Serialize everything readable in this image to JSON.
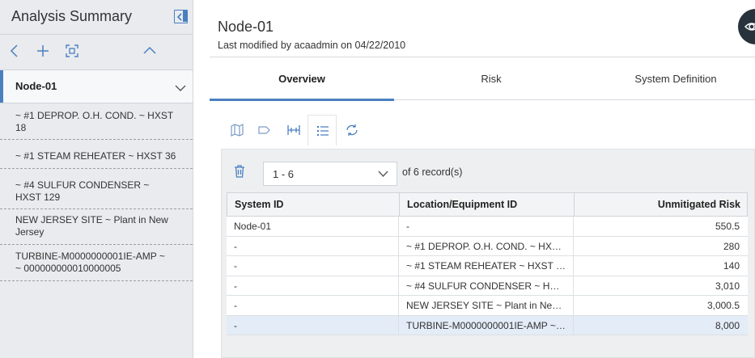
{
  "sidebar": {
    "title": "Analysis Summary",
    "selected": "Node-01",
    "items": [
      {
        "line1": "~ #1 DEPROP. O.H. COND. ~ HXST",
        "line2": "18"
      },
      {
        "line1": "~ #1 STEAM REHEATER ~ HXST 36",
        "line2": ""
      },
      {
        "line1": "~ #4 SULFUR CONDENSER ~",
        "line2": "HXST 129"
      },
      {
        "line1": "NEW JERSEY SITE ~ Plant in New",
        "line2": "Jersey"
      },
      {
        "line1": "TURBINE-M0000000001IE-AMP ~",
        "line2": "~ 000000000010000005"
      }
    ],
    "toolbar_icons": [
      "back-icon",
      "add-icon",
      "fit-to-screen-icon",
      "chevron-up-icon"
    ]
  },
  "header": {
    "title": "Node-01",
    "subtitle": "Last modified by acaadmin on 04/22/2010",
    "badge_icon": "eye-icon"
  },
  "tabs": [
    {
      "label": "Overview",
      "active": true
    },
    {
      "label": "Risk",
      "active": false
    },
    {
      "label": "System Definition",
      "active": false
    }
  ],
  "view_icons": [
    "map-view-icon",
    "tag-view-icon",
    "hierarchy-view-icon",
    "list-view-icon",
    "refresh-icon"
  ],
  "records": {
    "range": "1 - 6",
    "of_label": "of",
    "total": "6",
    "suffix": "record(s)"
  },
  "grid": {
    "columns": [
      "System ID",
      "Location/Equipment ID",
      "Unmitigated Risk"
    ],
    "rows": [
      [
        "Node-01",
        "-",
        "550.5"
      ],
      [
        "-",
        "~ #1 DEPROP. O.H. COND. ~ HXST 18",
        "280"
      ],
      [
        "-",
        "~ #1 STEAM REHEATER ~ HXST 36",
        "140"
      ],
      [
        "-",
        "~ #4 SULFUR CONDENSER ~ HXST 129",
        "3,010"
      ],
      [
        "-",
        "NEW JERSEY SITE ~ Plant in New Jersey",
        "3,000.5"
      ],
      [
        "-",
        "TURBINE-M0000000001IE-AMP ~ ~ 000000000010000005",
        "8,000"
      ]
    ],
    "selected_row": 5
  },
  "colors": {
    "accent": "#4a7fc0",
    "sidebar_bg": "#e9ebee",
    "selected_row": "#e3ecf7",
    "badge": "#27323c"
  }
}
